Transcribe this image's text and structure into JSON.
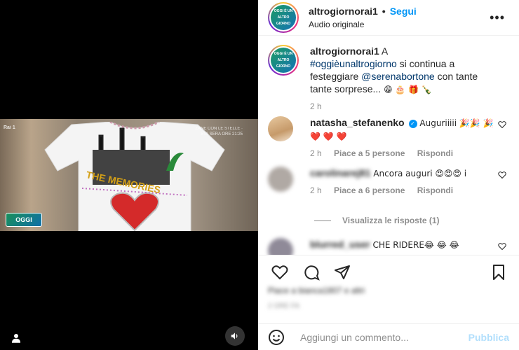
{
  "account": {
    "username": "altrogiornorai1",
    "follow_label": "Segui",
    "audio": "Audio originale",
    "more": "•••",
    "logo_text": "OGGI È UN ALTRO GIORNO"
  },
  "video": {
    "rai_tag": "Rai 1",
    "tv_logo": "OGGI",
    "caption_corner": "ZANE CON LE STELLE · STA SERA ORE 21:25",
    "shirt_text": "THE MEMORIES"
  },
  "caption": {
    "username": "altrogiornorai1",
    "lead": "A",
    "hashtag": "#oggièunaltrogiorno",
    "mid": "si continua a festeggiare",
    "mention": "@serenabortone",
    "tail": "con tante tante sorprese...",
    "emojis": "😁 🎂 🎁 🍾",
    "time": "2 h"
  },
  "comments": [
    {
      "username": "natasha_stefanenko",
      "text": "Auguriiiii 🎉🎉 🎉 ❤️ ❤️ ❤️",
      "time": "2 h",
      "likes": "Piace a 5 persone",
      "reply": "Rispondi"
    },
    {
      "username": "carolinarej81",
      "text": "Ancora auguri 😍😍😍 i",
      "time": "2 h",
      "likes": "Piace a 6 persone",
      "reply": "Rispondi"
    },
    {
      "username": "blurred_user",
      "text": "CHE RIDERE😂 😂 😂"
    }
  ],
  "view_replies": "Visualizza le risposte (1)",
  "likes_line": "Piace a bianca1807 e altri",
  "date_line": "2 ORE FA",
  "composer": {
    "placeholder": "Aggiungi un commento...",
    "publish": "Pubblica"
  }
}
